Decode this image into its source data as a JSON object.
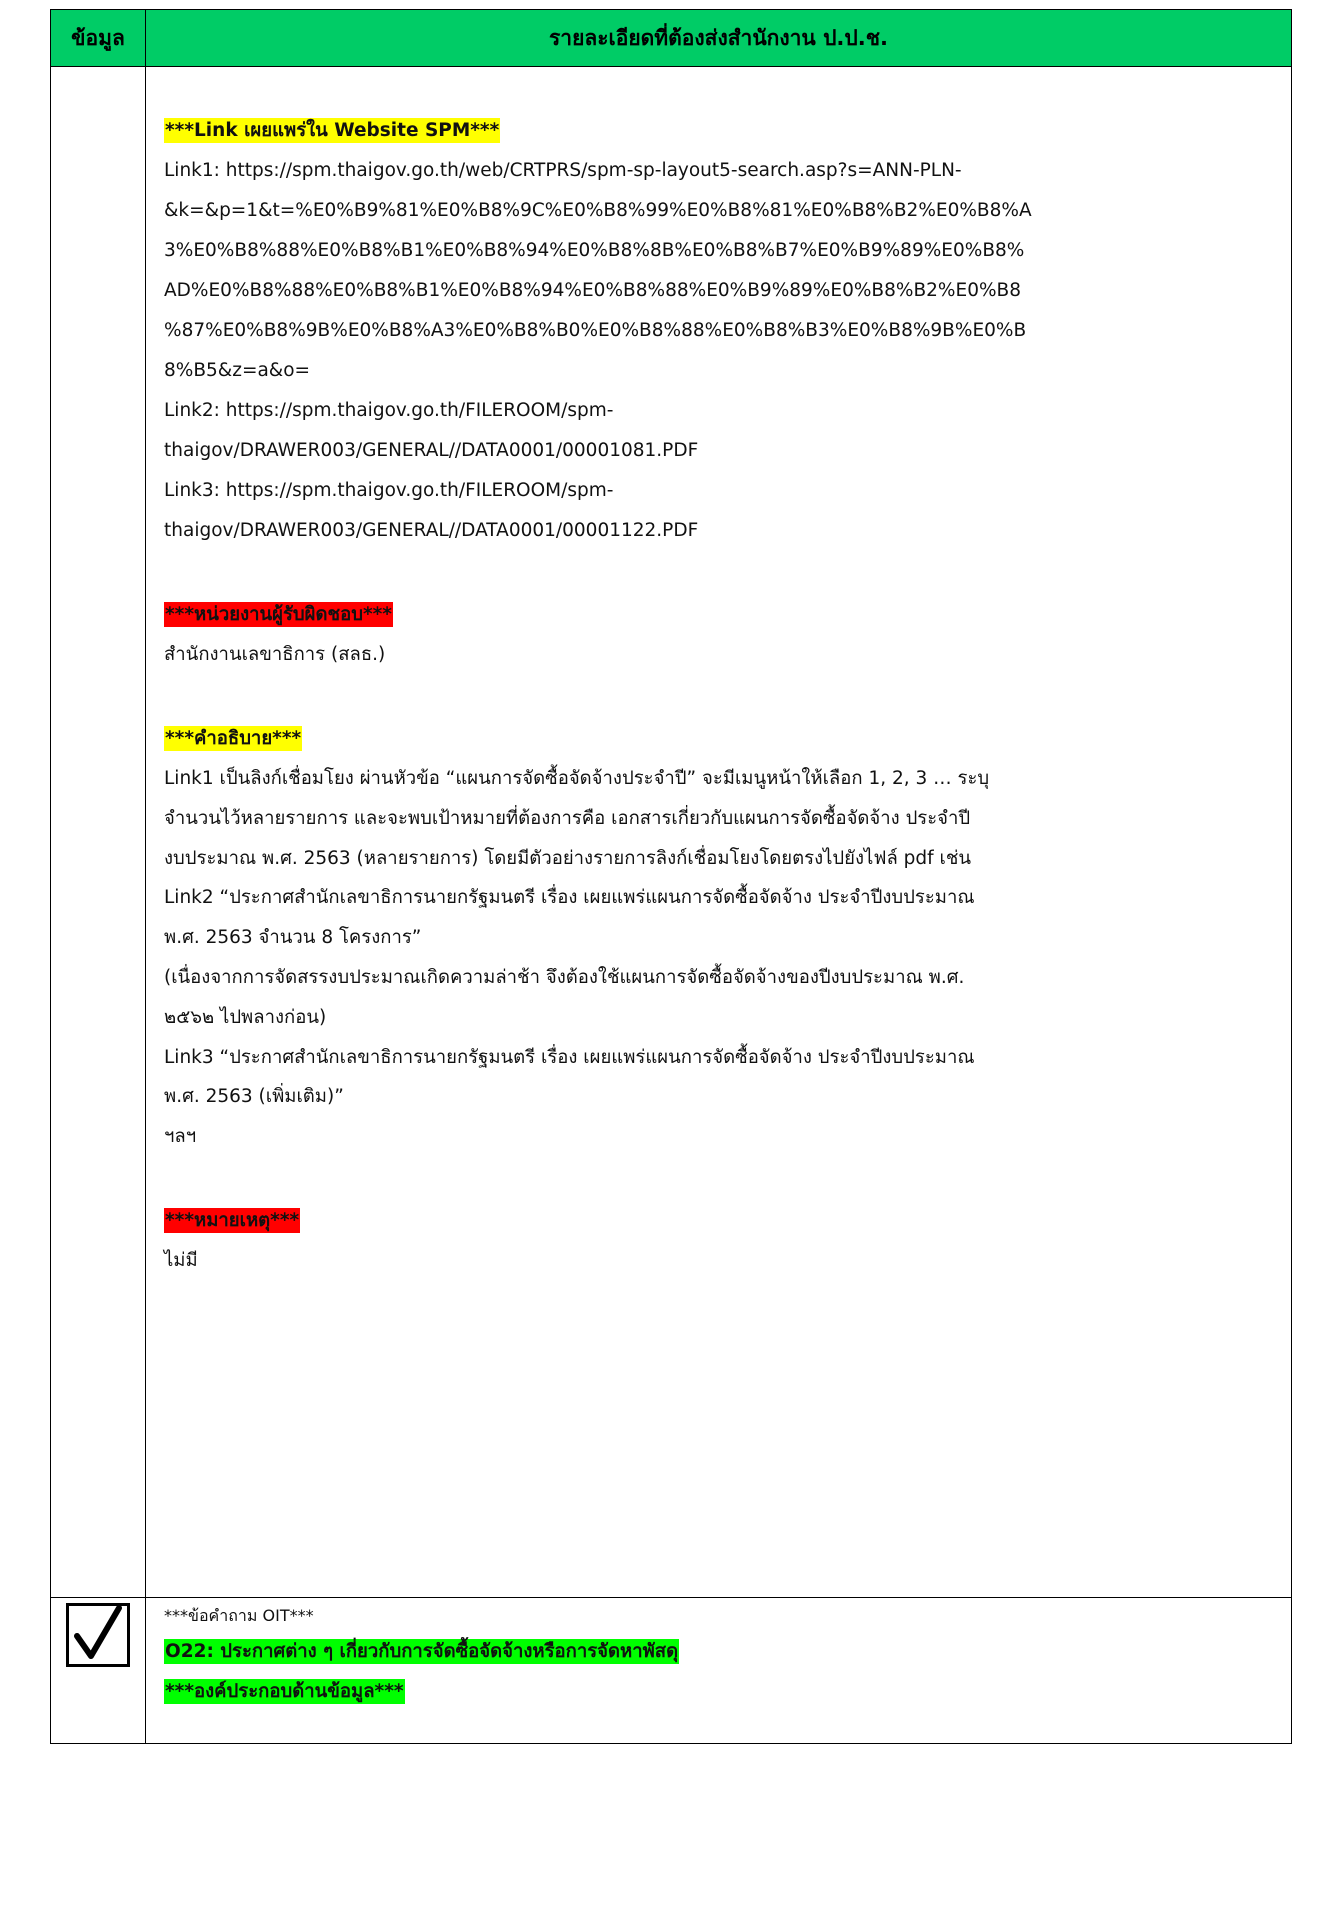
{
  "table": {
    "header": {
      "col1": "ข้อมูล",
      "col2": "รายละเอียดที่ต้องส่งสำนักงาน ป.ป.ช."
    }
  },
  "links_section": {
    "heading": "***Link เผยแพร่ใน Website SPM***",
    "lines": [
      "Link1: https://spm.thaigov.go.th/web/CRTPRS/spm-sp-layout5-search.asp?s=ANN-PLN-",
      "&k=&p=1&t=%E0%B9%81%E0%B8%9C%E0%B8%99%E0%B8%81%E0%B8%B2%E0%B8%A",
      "3%E0%B8%88%E0%B8%B1%E0%B8%94%E0%B8%8B%E0%B8%B7%E0%B9%89%E0%B8%",
      "AD%E0%B8%88%E0%B8%B1%E0%B8%94%E0%B8%88%E0%B9%89%E0%B8%B2%E0%B8",
      "%87%E0%B8%9B%E0%B8%A3%E0%B8%B0%E0%B8%88%E0%B8%B3%E0%B8%9B%E0%B",
      "8%B5&z=a&o=",
      "Link2: https://spm.thaigov.go.th/FILEROOM/spm-",
      "thaigov/DRAWER003/GENERAL//DATA0001/00001081.PDF",
      "Link3: https://spm.thaigov.go.th/FILEROOM/spm-",
      "thaigov/DRAWER003/GENERAL//DATA0001/00001122.PDF"
    ]
  },
  "responsible_section": {
    "heading": "***หน่วยงานผู้รับผิดชอบ***",
    "text": "สำนักงานเลขาธิการ (สลธ.)"
  },
  "description_section": {
    "heading": "***คำอธิบาย***",
    "lines": [
      "Link1 เป็นลิงก์เชื่อมโยง ผ่านหัวข้อ “แผนการจัดซื้อจัดจ้างประจำปี” จะมีเมนูหน้าให้เลือก 1, 2, 3 … ระบุ",
      "จำนวนไว้หลายรายการ และจะพบเป้าหมายที่ต้องการคือ เอกสารเกี่ยวกับแผนการจัดซื้อจัดจ้าง ประจำปี",
      "งบประมาณ พ.ศ. 2563 (หลายรายการ) โดยมีตัวอย่างรายการลิงก์เชื่อมโยงโดยตรงไปยังไฟล์ pdf เช่น",
      "Link2 “ประกาศสำนักเลขาธิการนายกรัฐมนตรี เรื่อง เผยแพร่แผนการจัดซื้อจัดจ้าง ประจำปีงบประมาณ",
      "พ.ศ. 2563 จำนวน 8 โครงการ”",
      "(เนื่องจากการจัดสรรงบประมาณเกิดความล่าช้า จึงต้องใช้แผนการจัดซื้อจัดจ้างของปีงบประมาณ พ.ศ.",
      "๒๕๖๒ ไปพลางก่อน)",
      "Link3 “ประกาศสำนักเลขาธิการนายกรัฐมนตรี เรื่อง เผยแพร่แผนการจัดซื้อจัดจ้าง ประจำปีงบประมาณ",
      "พ.ศ. 2563 (เพิ่มเติม)”",
      "ฯลฯ"
    ]
  },
  "note_section": {
    "heading": "***หมายเหตุ***",
    "text": "ไม่มี"
  },
  "question_section": {
    "label": "***ข้อคำถาม OIT***",
    "item": "O22: ประกาศต่าง ๆ เกี่ยวกับการจัดซื้อจัดจ้างหรือการจัดหาพัสดุ",
    "component": "***องค์ประกอบด้านข้อมูล***"
  }
}
